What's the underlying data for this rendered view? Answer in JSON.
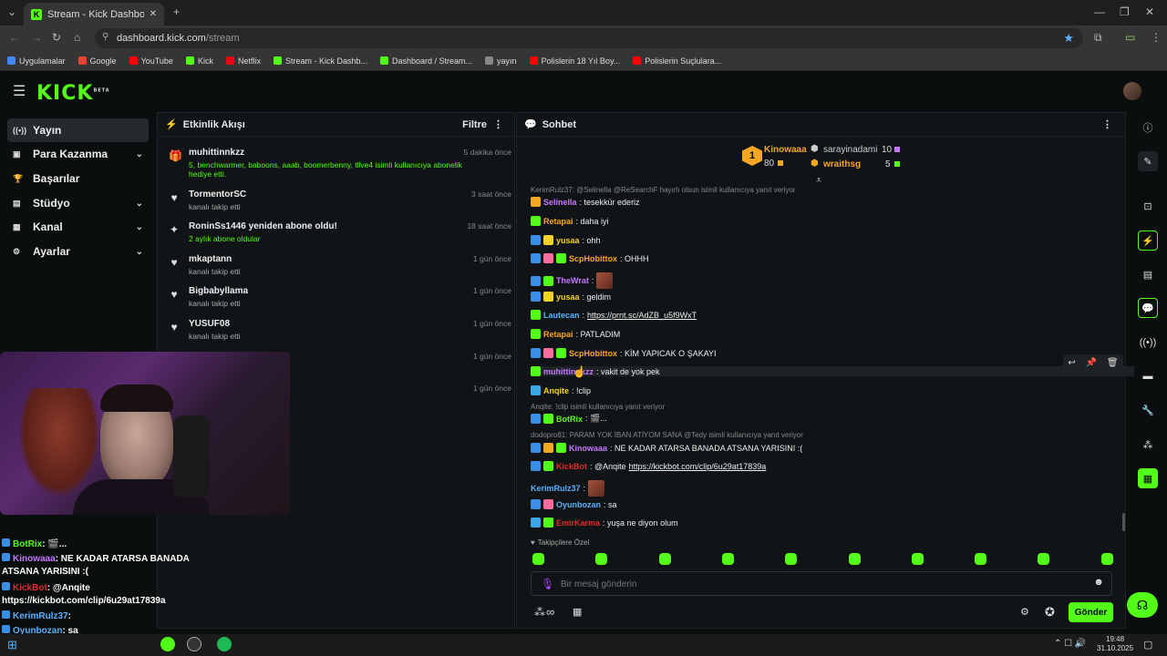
{
  "browser": {
    "tab_title": "Stream - Kick Dashboard",
    "url_domain": "dashboard.kick.com",
    "url_path": "/stream",
    "bookmarks": [
      {
        "label": "Uygulamalar",
        "color": "#4285f4"
      },
      {
        "label": "Google",
        "color": "#ea4335"
      },
      {
        "label": "YouTube",
        "color": "#ff0000"
      },
      {
        "label": "Kick",
        "color": "#53fc18"
      },
      {
        "label": "Netflix",
        "color": "#e50914"
      },
      {
        "label": "Stream - Kick Dashb...",
        "color": "#53fc18"
      },
      {
        "label": "Dashboard / Stream...",
        "color": "#53fc18"
      },
      {
        "label": "yayın",
        "color": "#888888"
      },
      {
        "label": "Polislerin 18 Yıl Boy...",
        "color": "#ff0000"
      },
      {
        "label": "Polislerin Suçlulara...",
        "color": "#ff0000"
      }
    ]
  },
  "logo": {
    "text": "KICK",
    "beta": "BETA"
  },
  "sidebar": {
    "items": [
      {
        "label": "Yayın",
        "icon": "broadcast-icon",
        "glyph": "((•))",
        "chevron": false
      },
      {
        "label": "Para Kazanma",
        "icon": "money-icon",
        "glyph": "▣",
        "chevron": true
      },
      {
        "label": "Başarılar",
        "icon": "trophy-icon",
        "glyph": "🏆",
        "chevron": false
      },
      {
        "label": "Stüdyo",
        "icon": "studio-icon",
        "glyph": "▤",
        "chevron": true
      },
      {
        "label": "Kanal",
        "icon": "channel-icon",
        "glyph": "▦",
        "chevron": true
      },
      {
        "label": "Ayarlar",
        "icon": "settings-icon",
        "glyph": "⚙",
        "chevron": true
      }
    ]
  },
  "activity": {
    "title": "Etkinlik Akışı",
    "filter_label": "Filtre",
    "events": [
      {
        "name": "muhittinnkzz",
        "sub": "5, benchwarmer, baboons, aaab, boomerbenny, tllve4 isimli kullanıcıya abonelik hediye etti.",
        "time": "5 dakika önce",
        "icon": "gift-icon",
        "glyph": "🎁"
      },
      {
        "name": "TormentorSC",
        "sub": "kanalı takip etti",
        "time": "3 saat önce",
        "icon": "heart-icon",
        "glyph": "♥"
      },
      {
        "name": "RoninSs1446 yeniden abone oldu!",
        "sub": "2 aylık abone oldular",
        "time": "18 saat önce",
        "icon": "star-icon",
        "glyph": "✦"
      },
      {
        "name": "mkaptann",
        "sub": "kanalı takip etti",
        "time": "1 gün önce",
        "icon": "heart-icon",
        "glyph": "♥"
      },
      {
        "name": "Bigbabyllama",
        "sub": "kanalı takip etti",
        "time": "1 gün önce",
        "icon": "heart-icon",
        "glyph": "♥"
      },
      {
        "name": "YUSUF08",
        "sub": "kanalı takip etti",
        "time": "1 gün önce",
        "icon": "heart-icon",
        "glyph": "♥"
      },
      {
        "name": "",
        "sub": "",
        "time": "1 gün önce",
        "icon": "",
        "glyph": ""
      },
      {
        "name": "",
        "sub": "",
        "time": "1 gün önce",
        "icon": "",
        "glyph": ""
      }
    ]
  },
  "chat": {
    "title": "Sohbet",
    "leaderboard": [
      {
        "rank": "1",
        "user": "Kinowaaa",
        "count": "80",
        "color": "#f5a623"
      },
      {
        "rank": "",
        "user": "sarayinadami",
        "count": "10",
        "color": "#cccccc"
      },
      {
        "rank": "",
        "user": "wraithsg",
        "count": "5",
        "color": "#f5a623"
      }
    ],
    "messages": [
      {
        "type": "reply",
        "text": "KerimRulz37: @Selinella @ReSearchF hayırlı olsun isimli kullanıcıya yanıt veriyor"
      },
      {
        "user": "Selinella",
        "color": "#c678ff",
        "text": ": tesekkür ederiz",
        "badges": [
          "#f5a623"
        ]
      },
      {
        "user": "Retapai",
        "color": "#f5a623",
        "text": ": daha iyi",
        "badges": [
          "#53fc18"
        ]
      },
      {
        "user": "yusaa",
        "color": "#f5d323",
        "text": ": ohh",
        "badges": [
          "#3a8ee6",
          "#f5d323"
        ]
      },
      {
        "user": "ScpHobittox",
        "color": "#f5a623",
        "text": ": OHHH",
        "badges": [
          "#3a8ee6",
          "#ff6b9a",
          "#53fc18"
        ]
      },
      {
        "user": "TheWrat",
        "color": "#c678ff",
        "text": ":",
        "badges": [
          "#3a8ee6",
          "#53fc18"
        ],
        "emote": true
      },
      {
        "user": "yusaa",
        "color": "#f5d323",
        "text": ": geldim",
        "badges": [
          "#3a8ee6",
          "#f5d323"
        ]
      },
      {
        "user": "Lautecan",
        "color": "#5ab0ff",
        "text": ": ",
        "link": "https://prnt.sc/AdZB_u5f9WxT",
        "badges": [
          "#53fc18"
        ]
      },
      {
        "user": "Retapai",
        "color": "#f5a623",
        "text": ": PATLADIM",
        "badges": [
          "#53fc18"
        ]
      },
      {
        "user": "ScpHobittox",
        "color": "#f5a623",
        "text": ": KİM YAPICAK O ŞAKAYI",
        "badges": [
          "#3a8ee6",
          "#ff6b9a",
          "#53fc18"
        ]
      },
      {
        "user": "muhittinnkzz",
        "color": "#c678ff",
        "text": ": vakit de yok pek",
        "badges": [
          "#53fc18"
        ],
        "highlight": true
      },
      {
        "user": "Anqite",
        "color": "#f5d323",
        "text": ": !clip",
        "badges": [
          "#3aa8e6"
        ]
      },
      {
        "type": "reply",
        "text": "Anqite: !clip isimli kullanıcıya yanıt veriyor"
      },
      {
        "user": "BotRix",
        "color": "#53fc18",
        "text": ": 🎬...",
        "badges": [
          "#3a8ee6",
          "#53fc18"
        ]
      },
      {
        "type": "reply",
        "text": "dodopro81: PARAM YOK İBAN ATİYOM SANA @Tedy isimli kullanıcıya yanıt veriyor"
      },
      {
        "user": "Kinowaaa",
        "color": "#c678ff",
        "text": ": NE KADAR ATARSA BANADA ATSANA YARISINI :(",
        "badges": [
          "#3a8ee6",
          "#f5a623",
          "#53fc18"
        ]
      },
      {
        "user": "KickBot",
        "color": "#e02a2a",
        "text": ": @Anqite ",
        "link": "https://kickbot.com/clip/6u29at17839a",
        "badges": [
          "#3a8ee6",
          "#53fc18"
        ]
      },
      {
        "user": "KerimRulz37",
        "color": "#5ab0ff",
        "text": ":",
        "badges": [],
        "emote": true
      },
      {
        "user": "Oyunbozan",
        "color": "#5ab0ff",
        "text": ": sa",
        "badges": [
          "#3a8ee6",
          "#ff6b9a"
        ]
      },
      {
        "user": "EmirKarma",
        "color": "#e02a2a",
        "text": ": yuşa ne diyon olum",
        "badges": [
          "#3aa8e6",
          "#53fc18"
        ]
      }
    ],
    "followers_only": "Takipçilere Özel",
    "input_placeholder": "Bir mesaj gönderin",
    "send_label": "Gönder",
    "infinity": "∞"
  },
  "overlay": [
    {
      "user": "BotRix",
      "color": "#53fc18",
      "text": ": 🎬..."
    },
    {
      "user": "Kinowaaa",
      "color": "#c678ff",
      "text": ": NE KADAR ATARSA BANADA"
    },
    {
      "user": "",
      "color": "#ffffff",
      "text": "ATSANA YARISINI :("
    },
    {
      "user": "KickBot",
      "color": "#e02a2a",
      "text": ": @Anqite"
    },
    {
      "user": "",
      "color": "#ffffff",
      "text": "https://kickbot.com/clip/6u29at17839a"
    },
    {
      "user": "KerimRulz37",
      "color": "#5ab0ff",
      "text": ":"
    },
    {
      "user": "Oyunbozan",
      "color": "#5ab0ff",
      "text": ": sa"
    },
    {
      "user": "EmirKarma",
      "color": "#e02a2a",
      "text": "yuşa ne diyon olum"
    }
  ],
  "taskbar": {
    "time": "19:48",
    "date": "31.10.2025"
  },
  "colors": {
    "accent": "#53fc18",
    "bg": "#0b0e0f",
    "panel": "#111416"
  }
}
